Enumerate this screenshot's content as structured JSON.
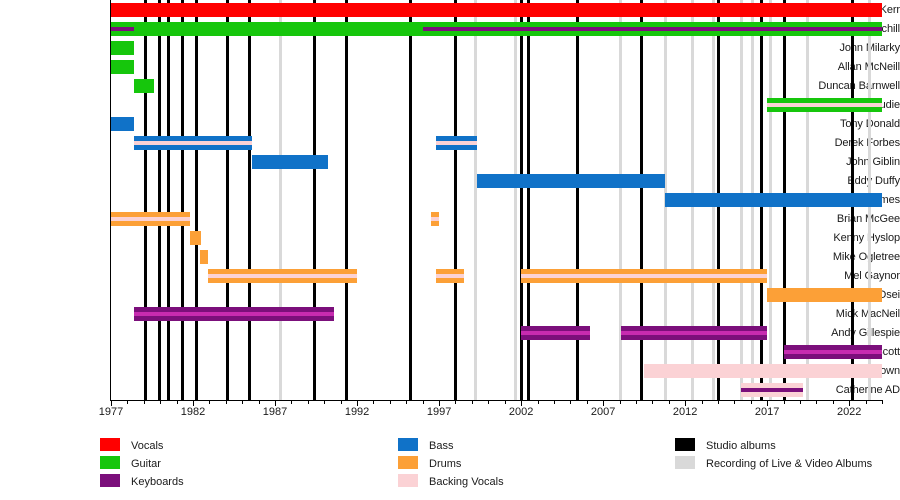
{
  "chart_data": {
    "type": "bar",
    "subtype": "timeline-gantt",
    "title": "",
    "xlabel": "",
    "ylabel": "",
    "xlim": [
      1977,
      2024
    ],
    "grid": true,
    "legend_position": "bottom",
    "axis": {
      "tick_labels": [
        "1977",
        "1982",
        "1987",
        "1992",
        "1997",
        "2002",
        "2007",
        "2012",
        "2017",
        "2022"
      ],
      "tick_values": [
        1977,
        1982,
        1987,
        1992,
        1997,
        2002,
        2007,
        2012,
        2017,
        2022
      ],
      "minor_tick_step": 1
    },
    "roles": [
      {
        "key": "vocals",
        "label": "Vocals",
        "color": "#ff0000"
      },
      {
        "key": "guitar",
        "label": "Guitar",
        "color": "#16c60c"
      },
      {
        "key": "keyboards",
        "label": "Keyboards",
        "color": "#7b0f7b"
      },
      {
        "key": "bass",
        "label": "Bass",
        "color": "#1072c8"
      },
      {
        "key": "drums",
        "label": "Drums",
        "color": "#fca037"
      },
      {
        "key": "backing_vocals",
        "label": "Backing Vocals",
        "color": "#fbd2d5"
      }
    ],
    "event_markers": [
      {
        "key": "studio",
        "label": "Studio albums",
        "color": "#000000"
      },
      {
        "key": "live",
        "label": "Recording of Live & Video Albums",
        "color": "#d9d9d9"
      }
    ],
    "studio_album_years": [
      1979.1,
      1979.9,
      1980.5,
      1981.3,
      1982.2,
      1984.1,
      1985.4,
      1989.4,
      1991.3,
      1995.2,
      1998.0,
      2002.0,
      2002.4,
      2005.4,
      2009.3,
      2014.0,
      2016.6,
      2018.0,
      2022.2
    ],
    "live_album_years": [
      1987.3,
      1999.2,
      2001.6,
      2008.0,
      2010.8,
      2012.4,
      2013.7,
      2015.4,
      2016.1,
      2017.2,
      2019.4,
      2023.2
    ],
    "members": [
      {
        "name": "Jim Kerr",
        "segments": [
          {
            "role": "vocals",
            "start": 1977.0,
            "end": 2024.0
          }
        ],
        "stripes": []
      },
      {
        "name": "Charlie Burchill",
        "segments": [
          {
            "role": "guitar",
            "start": 1977.0,
            "end": 2024.0
          }
        ],
        "stripes": [
          {
            "role": "keyboards",
            "start": 1977.0,
            "end": 1978.4
          },
          {
            "role": "keyboards",
            "start": 1996.0,
            "end": 2024.0
          }
        ]
      },
      {
        "name": "John Milarky",
        "segments": [
          {
            "role": "guitar",
            "start": 1977.0,
            "end": 1978.4
          }
        ],
        "stripes": []
      },
      {
        "name": "Allan McNeill",
        "segments": [
          {
            "role": "guitar",
            "start": 1977.0,
            "end": 1978.4
          }
        ],
        "stripes": []
      },
      {
        "name": "Duncan Barnwell",
        "segments": [
          {
            "role": "guitar",
            "start": 1978.4,
            "end": 1979.6
          }
        ],
        "stripes": []
      },
      {
        "name": "Gordon Goudie",
        "segments": [
          {
            "role": "guitar",
            "start": 2017.0,
            "end": 2024.0
          }
        ],
        "stripes": [
          {
            "role": "backing_vocals",
            "start": 2017.0,
            "end": 2024.0
          }
        ]
      },
      {
        "name": "Tony Donald",
        "segments": [
          {
            "role": "bass",
            "start": 1977.0,
            "end": 1978.4
          }
        ],
        "stripes": []
      },
      {
        "name": "Derek Forbes",
        "segments": [
          {
            "role": "bass",
            "start": 1978.4,
            "end": 1985.6
          },
          {
            "role": "bass",
            "start": 1996.8,
            "end": 1999.3
          }
        ],
        "stripes": [
          {
            "role": "backing_vocals",
            "start": 1978.4,
            "end": 1985.6
          },
          {
            "role": "backing_vocals",
            "start": 1996.8,
            "end": 1999.3
          }
        ]
      },
      {
        "name": "John Giblin",
        "segments": [
          {
            "role": "bass",
            "start": 1985.6,
            "end": 1990.2
          }
        ],
        "stripes": []
      },
      {
        "name": "Eddy Duffy",
        "segments": [
          {
            "role": "bass",
            "start": 1999.3,
            "end": 2010.8
          }
        ],
        "stripes": []
      },
      {
        "name": "Ged Grimes",
        "segments": [
          {
            "role": "bass",
            "start": 2010.8,
            "end": 2024.0
          }
        ],
        "stripes": []
      },
      {
        "name": "Brian McGee",
        "segments": [
          {
            "role": "drums",
            "start": 1977.0,
            "end": 1981.8
          },
          {
            "role": "drums",
            "start": 1996.5,
            "end": 1997.0
          }
        ],
        "stripes": [
          {
            "role": "backing_vocals",
            "start": 1977.0,
            "end": 1981.8
          },
          {
            "role": "backing_vocals",
            "start": 1996.5,
            "end": 1997.0
          }
        ]
      },
      {
        "name": "Kenny Hyslop",
        "segments": [
          {
            "role": "drums",
            "start": 1981.8,
            "end": 1982.5
          }
        ],
        "stripes": []
      },
      {
        "name": "Mike Ogletree",
        "segments": [
          {
            "role": "drums",
            "start": 1982.4,
            "end": 1982.9
          }
        ],
        "stripes": []
      },
      {
        "name": "Mel Gaynor",
        "segments": [
          {
            "role": "drums",
            "start": 1982.9,
            "end": 1992.0
          },
          {
            "role": "drums",
            "start": 1996.8,
            "end": 1998.5
          },
          {
            "role": "drums",
            "start": 2002.0,
            "end": 2017.0
          }
        ],
        "stripes": [
          {
            "role": "backing_vocals",
            "start": 1982.9,
            "end": 1992.0
          },
          {
            "role": "backing_vocals",
            "start": 1996.8,
            "end": 1998.5
          },
          {
            "role": "backing_vocals",
            "start": 2002.0,
            "end": 2017.0
          }
        ]
      },
      {
        "name": "Cherisse Osei",
        "segments": [
          {
            "role": "drums",
            "start": 2017.0,
            "end": 2024.0
          }
        ],
        "stripes": []
      },
      {
        "name": "Mick MacNeil",
        "segments": [
          {
            "role": "keyboards",
            "start": 1978.4,
            "end": 1990.6
          }
        ],
        "stripes": [
          {
            "role": "keyboards_light",
            "start": 1978.4,
            "end": 1990.6
          }
        ]
      },
      {
        "name": "Andy Gillespie",
        "segments": [
          {
            "role": "keyboards",
            "start": 2002.0,
            "end": 2006.2
          },
          {
            "role": "keyboards",
            "start": 2008.1,
            "end": 2017.0
          }
        ],
        "stripes": [
          {
            "role": "keyboards_light",
            "start": 2002.0,
            "end": 2006.2
          },
          {
            "role": "keyboards_light",
            "start": 2008.1,
            "end": 2017.0
          }
        ]
      },
      {
        "name": "Berenice Scott",
        "segments": [
          {
            "role": "keyboards",
            "start": 2018.0,
            "end": 2024.0
          }
        ],
        "stripes": [
          {
            "role": "keyboards_light",
            "start": 2018.0,
            "end": 2024.0
          }
        ]
      },
      {
        "name": "Sarah Brown",
        "segments": [
          {
            "role": "backing_vocals",
            "start": 2009.5,
            "end": 2024.0
          }
        ],
        "stripes": []
      },
      {
        "name": "Catherine AD",
        "segments": [
          {
            "role": "backing_vocals",
            "start": 2015.4,
            "end": 2019.2
          }
        ],
        "stripes": [
          {
            "role": "keyboards",
            "start": 2015.4,
            "end": 2019.2
          }
        ]
      }
    ]
  },
  "legend": {
    "columns": [
      {
        "items": [
          {
            "label": "Vocals",
            "color": "#ff0000"
          },
          {
            "label": "Guitar",
            "color": "#16c60c"
          },
          {
            "label": "Keyboards",
            "color": "#7b0f7b"
          }
        ]
      },
      {
        "items": [
          {
            "label": "Bass",
            "color": "#1072c8"
          },
          {
            "label": "Drums",
            "color": "#fca037"
          },
          {
            "label": "Backing Vocals",
            "color": "#fbd2d5"
          }
        ]
      },
      {
        "items": [
          {
            "label": "Studio albums",
            "color": "#000000"
          },
          {
            "label": "Recording of Live & Video Albums",
            "color": "#d9d9d9"
          }
        ]
      }
    ]
  }
}
